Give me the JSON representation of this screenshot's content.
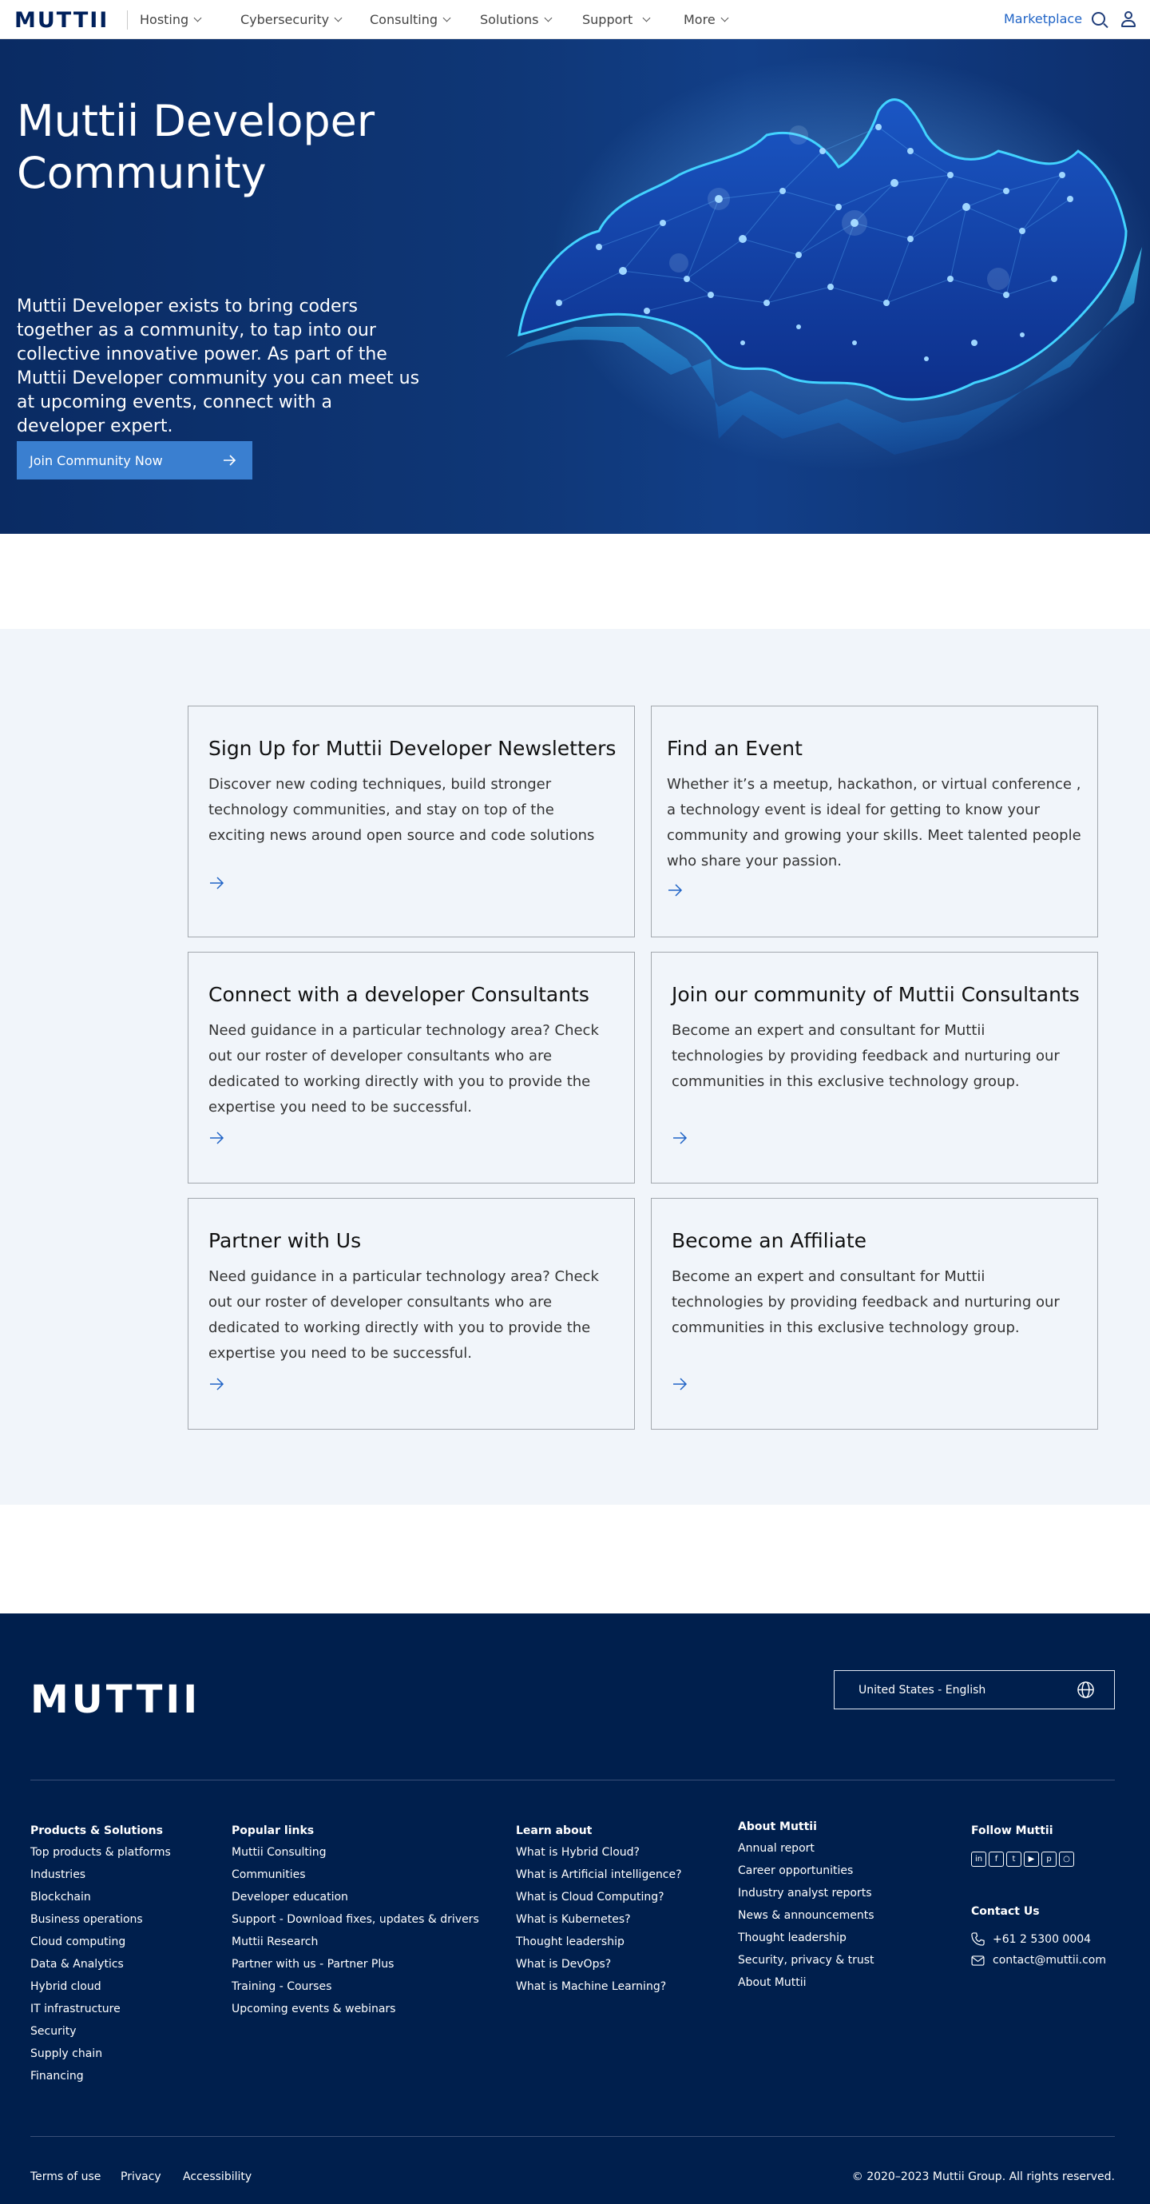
{
  "nav": {
    "logo": "MUTTII",
    "items": [
      {
        "label": "Hosting"
      },
      {
        "label": "Cybersecurity"
      },
      {
        "label": "Consulting"
      },
      {
        "label": "Solutions"
      },
      {
        "label": "Support"
      },
      {
        "label": "More"
      }
    ],
    "marketplace": "Marketplace"
  },
  "hero": {
    "title": "Muttii Developer Community",
    "text": "Muttii Developer exists to bring coders together as a community, to tap into our collective innovative power. As part of the Muttii Developer community you can meet us at upcoming events, connect with a developer expert.",
    "button": "Join Community Now"
  },
  "cards": [
    {
      "title": "Sign Up for Muttii Developer Newsletters",
      "text": "Discover new coding techniques, build stronger technology communities, and stay on top of the exciting news around open source and code solutions"
    },
    {
      "title": "Find an Event",
      "text": "Whether it’s a meetup, hackathon, or virtual conference , a technology event is ideal for getting to know your community and growing your skills. Meet talented people who share your passion."
    },
    {
      "title": "Connect with a developer Consultants",
      "text": "Need guidance in  a particular technology area? Check out our roster of developer consultants who are dedicated to working directly with you to provide the expertise you need to be successful."
    },
    {
      "title": "Join our community of Muttii Consultants",
      "text": "Become an expert and consultant for Muttii technologies by providing feedback and nurturing our communities in this exclusive technology group."
    },
    {
      "title": "Partner with Us",
      "text": "Need guidance in  a particular technology area? Check out our roster of developer consultants who are dedicated to working directly with you to provide the expertise you need to be successful."
    },
    {
      "title": "Become an Affiliate",
      "text": "Become an expert and consultant for Muttii technologies by providing feedback and nurturing our communities in this exclusive technology group."
    }
  ],
  "footer": {
    "logo": "MUTTII",
    "language": "United States - English",
    "columns": [
      {
        "heading": "Products & Solutions",
        "links": [
          "Top products & platforms",
          "Industries",
          "Blockchain",
          "Business operations",
          "Cloud computing",
          "Data & Analytics",
          "Hybrid cloud",
          "IT infrastructure",
          "Security",
          "Supply chain",
          "Financing"
        ]
      },
      {
        "heading": "Popular links",
        "links": [
          "Muttii Consulting",
          "Communities",
          "Developer education",
          "Support - Download fixes, updates & drivers",
          "Muttii Research",
          "Partner with us - Partner Plus",
          "Training - Courses",
          "Upcoming events & webinars"
        ]
      },
      {
        "heading": "Learn about",
        "links": [
          "What is Hybrid Cloud?",
          "What is Artificial intelligence?",
          "What is Cloud Computing?",
          "What is Kubernetes?",
          "Thought leadership",
          "What is DevOps?",
          "What is Machine Learning?"
        ]
      },
      {
        "heading": "About Muttii",
        "links": [
          "Annual report",
          "Career opportunities",
          "Industry analyst reports",
          "News & announcements",
          "Thought leadership",
          "Security, privacy & trust",
          "About Muttii"
        ]
      }
    ],
    "follow": {
      "heading": "Follow Muttii",
      "icons": [
        "linkedin-icon",
        "facebook-icon",
        "twitter-icon",
        "youtube-icon",
        "pinterest-icon",
        "instagram-icon"
      ]
    },
    "contact": {
      "heading": "Contact Us",
      "phone": "+61 2 5300 0004",
      "email": "contact@muttii.com"
    },
    "bottom": {
      "terms": "Terms of use",
      "privacy": "Privacy",
      "accessibility": "Accessibility",
      "copyright": "© 2020–2023 Muttii Group. All rights reserved."
    }
  },
  "colors": {
    "brand_navy": "#00205b",
    "link_blue": "#1f63c6",
    "button_blue": "#3a7fd0",
    "footer_bg": "#001f4d",
    "cards_bg": "#f1f5fa"
  }
}
